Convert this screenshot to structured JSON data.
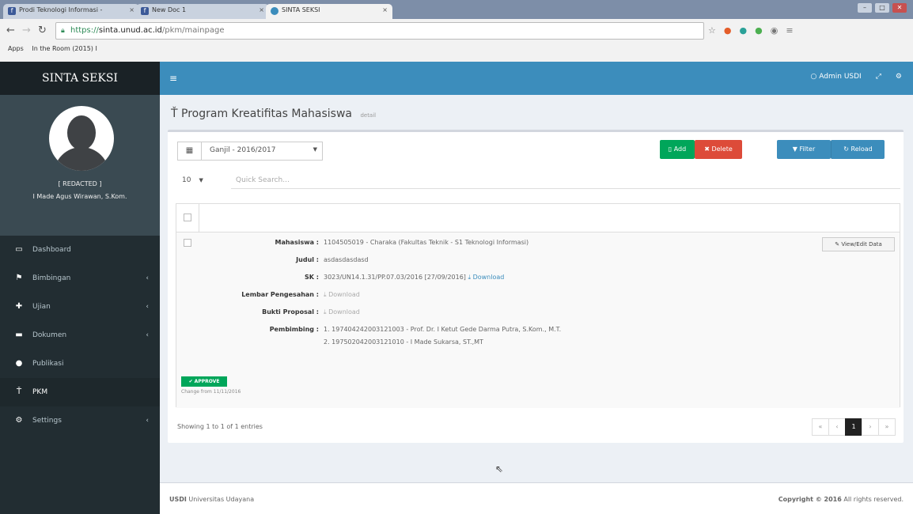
{
  "browser": {
    "tabs": [
      {
        "label": "Prodi Teknologi Informasi -"
      },
      {
        "label": "New Doc 1"
      },
      {
        "label": "SINTA SEKSI"
      }
    ],
    "url_scheme": "https://",
    "url_host": "sinta.unud.ac.id",
    "url_path": "/pkm/mainpage",
    "bookmarks": [
      "Apps",
      "In the Room (2015) I"
    ]
  },
  "app": {
    "logo": "SINTA SEKSI",
    "user_name": "[ REDACTED ]",
    "user_role": "I Made Agus Wirawan, S.Kom.",
    "admin_label": "Admin USDI"
  },
  "menu": [
    {
      "label": "Dashboard",
      "icon": "monitor-icon",
      "glyph": "▭",
      "expand": ""
    },
    {
      "label": "Bimbingan",
      "icon": "flag-icon",
      "glyph": "⚑",
      "expand": "‹"
    },
    {
      "label": "Ujian",
      "icon": "pin-icon",
      "glyph": "✚",
      "expand": "‹"
    },
    {
      "label": "Dokumen",
      "icon": "folder-icon",
      "glyph": "▬",
      "expand": "‹"
    },
    {
      "label": "Publikasi",
      "icon": "globe-icon",
      "glyph": "●",
      "expand": ""
    },
    {
      "label": "PKM",
      "icon": "trophy-icon",
      "glyph": "Ť",
      "expand": ""
    },
    {
      "label": "Settings",
      "icon": "cogs-icon",
      "glyph": "⚙",
      "expand": "‹"
    }
  ],
  "page": {
    "title": "Program Kreatifitas Mahasiswa",
    "subtitle": "detail",
    "semester": "Ganjil - 2016/2017",
    "buttons": {
      "add": "Add",
      "delete": "Delete",
      "filter": "Filter",
      "reload": "Reload"
    },
    "page_size": "10",
    "search_placeholder": "Quick Search..."
  },
  "record": {
    "labels": {
      "mahasiswa": "Mahasiswa :",
      "judul": "Judul :",
      "sk": "SK :",
      "lembar": "Lembar Pengesahan :",
      "bukti": "Bukti Proposal :",
      "pembimbing": "Pembimbing :"
    },
    "mahasiswa": "1104505019 - Charaka (Fakultas Teknik - S1 Teknologi Informasi)",
    "judul": "asdasdasdasd",
    "sk": "3023/UN14.1.31/PP.07.03/2016 [27/09/2016]",
    "download": "Download",
    "pembimbing_1": "1. 197404242003121003 - Prof. Dr. I Ketut Gede Darma Putra, S.Kom., M.T.",
    "pembimbing_2": "2. 197502042003121010 - I Made Sukarsa, ST.,MT",
    "view_edit": "View/Edit Data",
    "status": "✔ APPROVE",
    "changed": "Change from 11/11/2016"
  },
  "table_footer": {
    "showing": "Showing 1 to 1 of 1 entries",
    "pages": [
      "«",
      "‹",
      "1",
      "›",
      "»"
    ]
  },
  "footer": {
    "left_bold": "USDI",
    "left": " Universitas Udayana",
    "right_bold": "Copyright © 2016",
    "right": " All rights reserved."
  }
}
